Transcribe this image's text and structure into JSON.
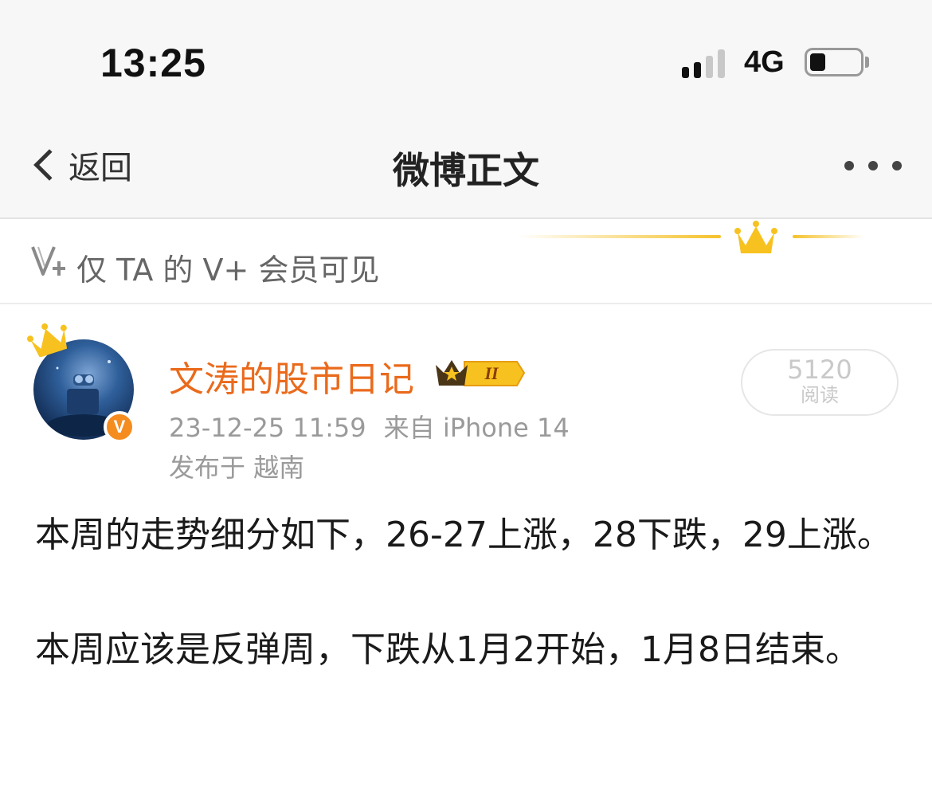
{
  "status_bar": {
    "time": "13:25",
    "network": "4G",
    "signal_bars_active": 2,
    "signal_bars_total": 4,
    "battery_level": 0.3
  },
  "nav": {
    "back_label": "返回",
    "title": "微博正文",
    "more_icon": "more-dots-icon"
  },
  "vip_notice": {
    "text": "仅 TA 的 V+ 会员可见",
    "icon": "vplus-icon",
    "accent_color": "#f5c22b"
  },
  "post": {
    "author": "文涛的股市日记",
    "author_color": "#ea6a1c",
    "member_level": "II",
    "verified_mark": "V",
    "read_count": "5120",
    "read_label": "阅读",
    "timestamp": "23-12-25 11:59",
    "source": "来自 iPhone 14",
    "location": "发布于 越南",
    "paragraphs": [
      "本周的走势细分如下，26-27上涨，28下跌，29上涨。",
      "本周应该是反弹周，下跌从1月2开始，1月8日结束。"
    ]
  }
}
